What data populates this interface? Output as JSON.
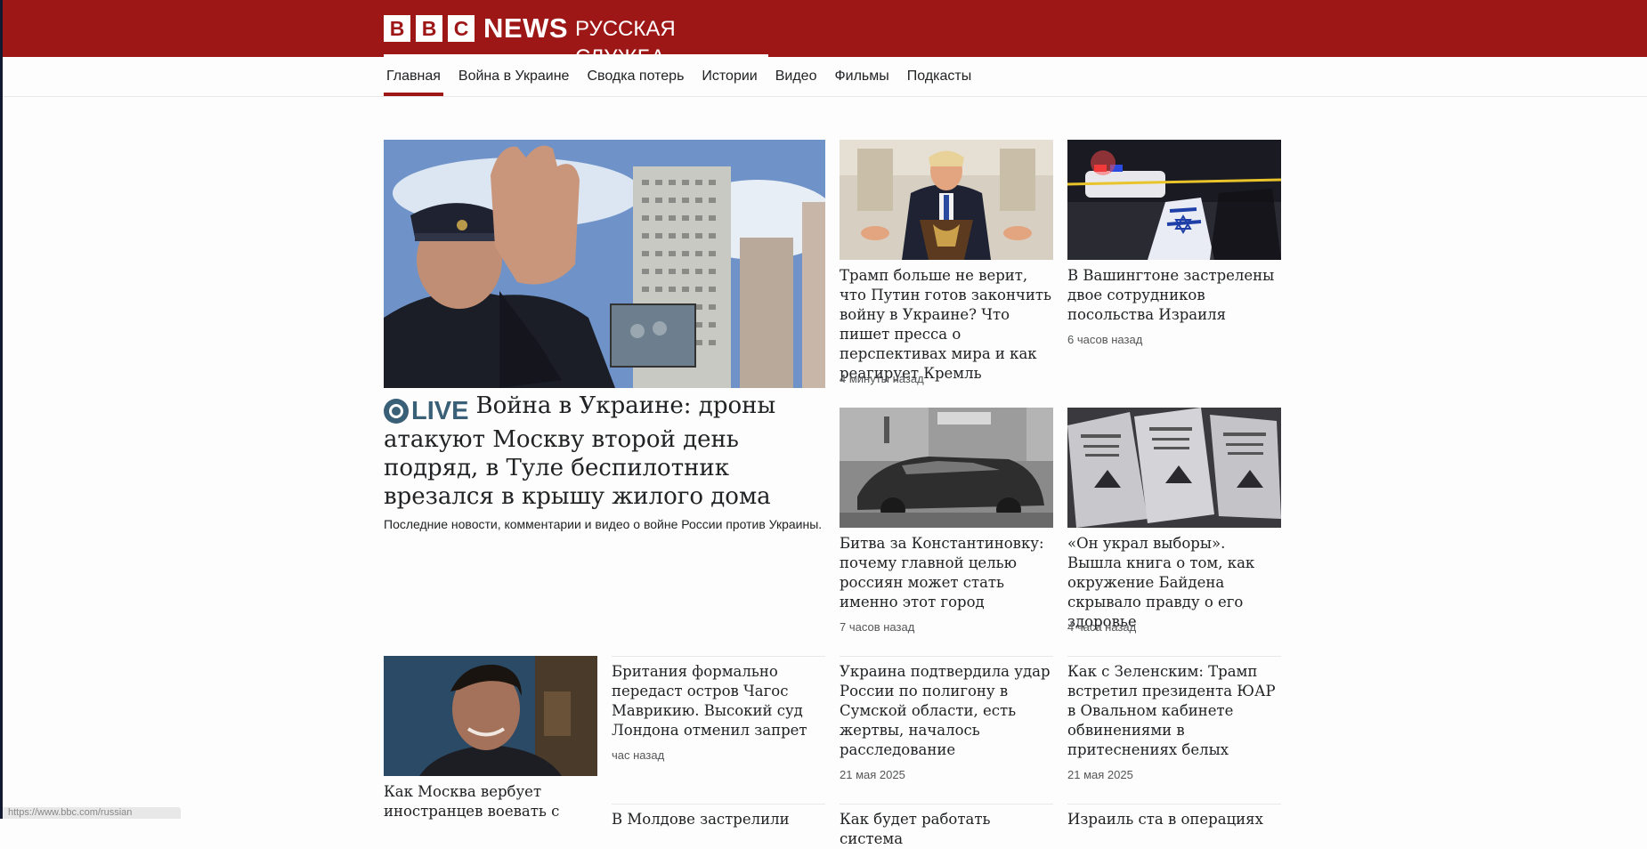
{
  "header": {
    "brand_letters": [
      "B",
      "B",
      "C"
    ],
    "brand_news": "NEWS",
    "brand_service": "РУССКАЯ СЛУЖБА"
  },
  "nav": {
    "items": [
      {
        "label": "Главная",
        "active": true
      },
      {
        "label": "Война в Украине",
        "active": false
      },
      {
        "label": "Сводка потерь",
        "active": false
      },
      {
        "label": "Истории",
        "active": false
      },
      {
        "label": "Видео",
        "active": false
      },
      {
        "label": "Фильмы",
        "active": false
      },
      {
        "label": "Подкасты",
        "active": false
      }
    ]
  },
  "lead": {
    "live_label": "LIVE",
    "title": "Война в Украине: дроны атакуют Москву второй день подряд, в Туле беспилотник врезался в крышу жилого дома",
    "summary": "Последние новости, комментарии и видео о войне России против Украины."
  },
  "stories": [
    {
      "title": "Трамп больше не верит, что Путин готов закончить войну в Украине? Что пишет пресса о перспективах мира и как реагирует Кремль",
      "time": "4 минуты назад"
    },
    {
      "title": "В Вашингтоне застрелены двое сотрудников посольства Израиля",
      "time": "6 часов назад"
    },
    {
      "title": "Битва за Константиновку: почему главной целью россиян может стать именно этот город",
      "time": "7 часов назад"
    },
    {
      "title": "«Он украл выборы». Вышла книга о том, как окружение Байдена скрывало правду о его здоровье",
      "time": "4 часа назад"
    },
    {
      "title": "Как Москва вербует иностранцев воевать с",
      "time": ""
    },
    {
      "title": "Британия формально передаст остров Чагос Маврикию. Высокий суд Лондона отменил запрет",
      "time": "час назад"
    },
    {
      "title": "Украина подтвердила удар России по полигону в Сумской области, есть жертвы, началось расследование",
      "time": "21 мая 2025"
    },
    {
      "title": "Как с Зеленским: Трамп встретил президента ЮАР в Овальном кабинете обвинениями в притеснениях белых",
      "time": "21 мая 2025"
    },
    {
      "title": "В Молдове застрелили",
      "time": ""
    },
    {
      "title": "Как будет работать система",
      "time": ""
    },
    {
      "title": "Израиль ста в операциях",
      "time": ""
    }
  ],
  "images": {
    "lead": "policeman-photo",
    "trump": "trump-podium-photo",
    "washington": "police-scene-photo",
    "car": "burned-car-photo",
    "book": "book-covers-photo",
    "young_man": "young-man-photo"
  },
  "status_bar": {
    "url": "https://www.bbc.com/russian"
  },
  "colors": {
    "masthead": "#9e1717",
    "live": "#3a6078",
    "text": "#202224",
    "muted": "#545658"
  }
}
